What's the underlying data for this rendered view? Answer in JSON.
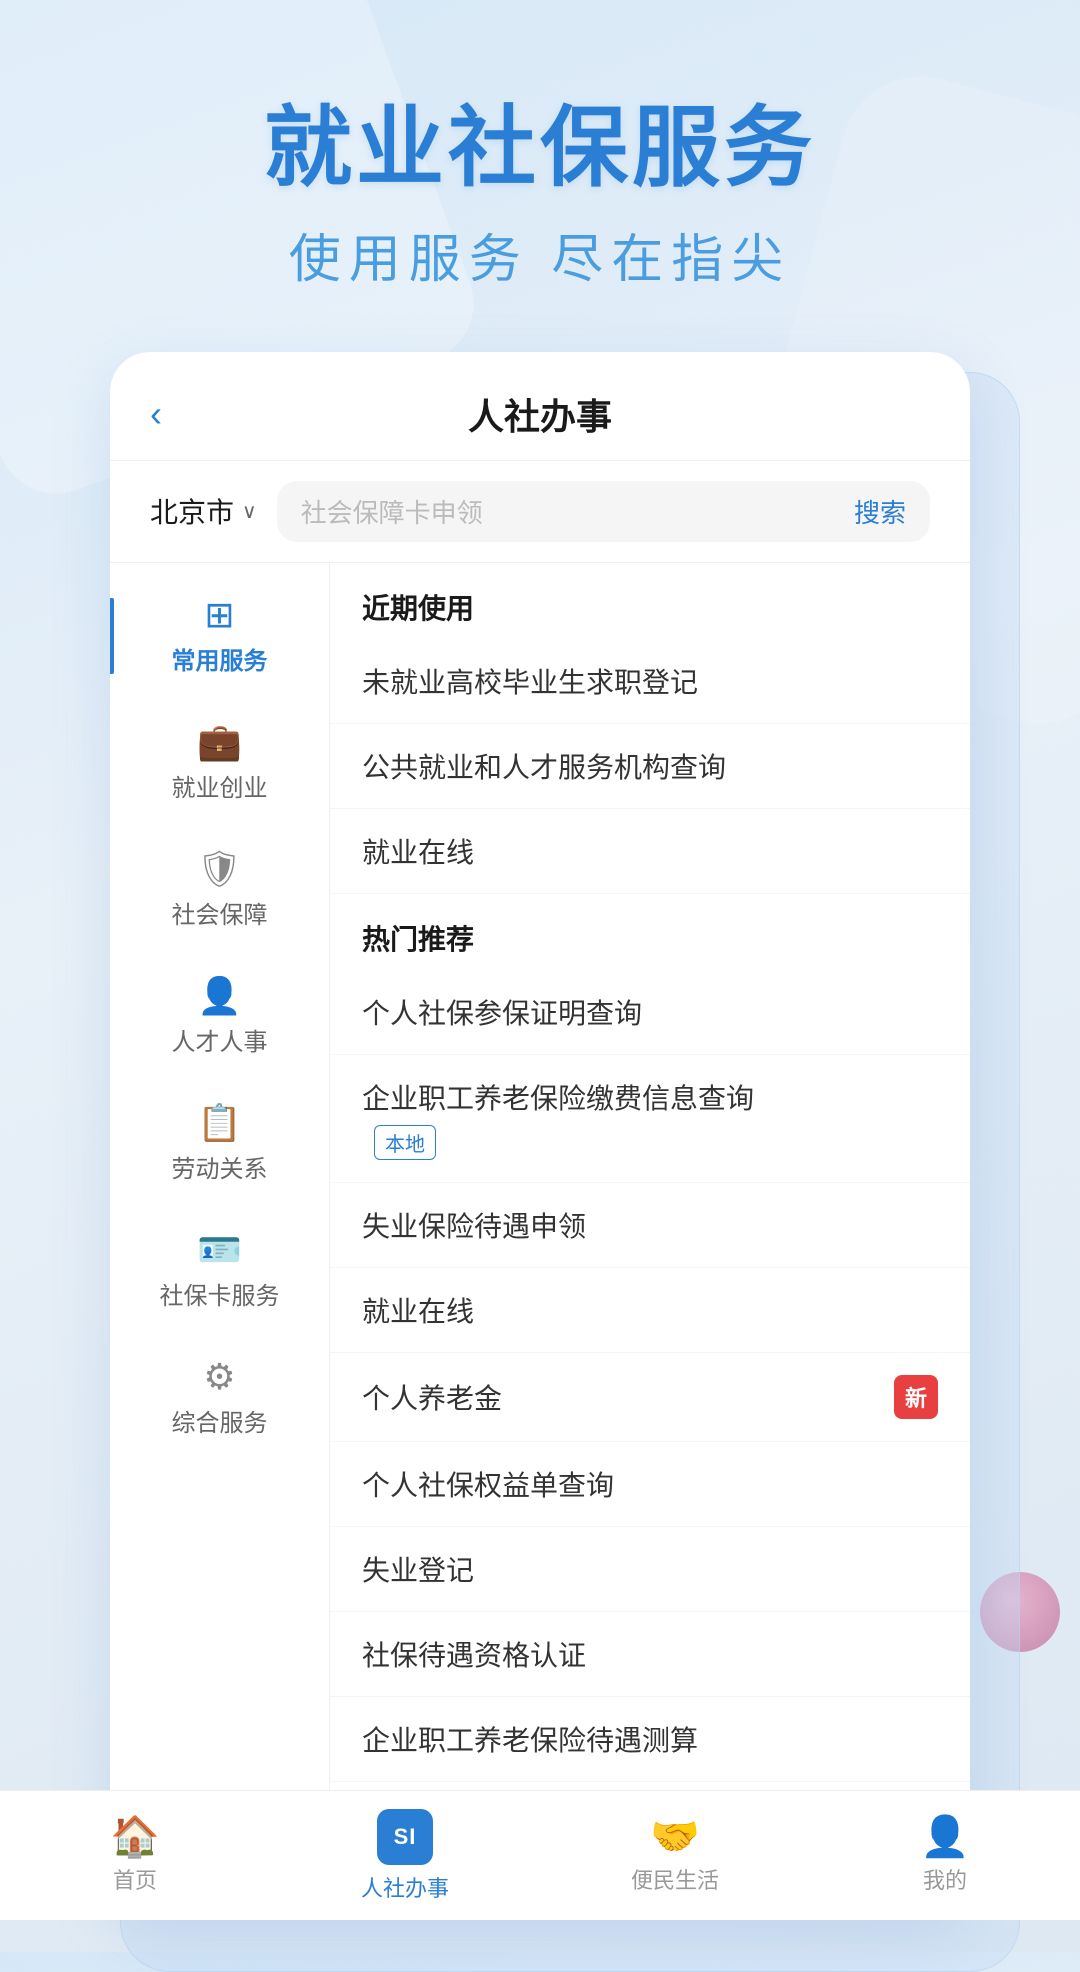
{
  "hero": {
    "title": "就业社保服务",
    "subtitle": "使用服务 尽在指尖"
  },
  "header": {
    "back_label": "‹",
    "title": "人社办事"
  },
  "search": {
    "city": "北京市",
    "placeholder": "社会保障卡申领",
    "button": "搜索"
  },
  "sidebar": {
    "items": [
      {
        "id": "common",
        "icon": "⊞",
        "label": "常用服务",
        "active": true
      },
      {
        "id": "employment",
        "icon": "🧳",
        "label": "就业创业",
        "active": false
      },
      {
        "id": "social",
        "icon": "🛡",
        "label": "社会保障",
        "active": false
      },
      {
        "id": "talent",
        "icon": "👤",
        "label": "人才人事",
        "active": false
      },
      {
        "id": "labor",
        "icon": "📋",
        "label": "劳动关系",
        "active": false
      },
      {
        "id": "card",
        "icon": "🪪",
        "label": "社保卡服务",
        "active": false
      },
      {
        "id": "general",
        "icon": "⚙",
        "label": "综合服务",
        "active": false
      }
    ]
  },
  "content": {
    "sections": [
      {
        "id": "recent",
        "title": "近期使用",
        "items": [
          {
            "id": "item1",
            "text": "未就业高校毕业生求职登记",
            "tag": null,
            "badge": null
          },
          {
            "id": "item2",
            "text": "公共就业和人才服务机构查询",
            "tag": null,
            "badge": null
          },
          {
            "id": "item3",
            "text": "就业在线",
            "tag": null,
            "badge": null
          }
        ]
      },
      {
        "id": "hot",
        "title": "热门推荐",
        "items": [
          {
            "id": "item4",
            "text": "个人社保参保证明查询",
            "tag": null,
            "badge": null
          },
          {
            "id": "item5",
            "text": "企业职工养老保险缴费信息查询",
            "tag": "本地",
            "badge": null
          },
          {
            "id": "item6",
            "text": "失业保险待遇申领",
            "tag": null,
            "badge": null
          },
          {
            "id": "item7",
            "text": "就业在线",
            "tag": null,
            "badge": null
          },
          {
            "id": "item8",
            "text": "个人养老金",
            "tag": null,
            "badge": "新"
          },
          {
            "id": "item9",
            "text": "个人社保权益单查询",
            "tag": null,
            "badge": null
          },
          {
            "id": "item10",
            "text": "失业登记",
            "tag": null,
            "badge": null
          },
          {
            "id": "item11",
            "text": "社保待遇资格认证",
            "tag": null,
            "badge": null
          },
          {
            "id": "item12",
            "text": "企业职工养老保险待遇测算",
            "tag": null,
            "badge": null
          }
        ]
      }
    ]
  },
  "bottom_nav": {
    "items": [
      {
        "id": "home",
        "icon": "🏠",
        "label": "首页",
        "active": false
      },
      {
        "id": "rshr",
        "label": "人社办事",
        "active": true,
        "si": true
      },
      {
        "id": "convenience",
        "icon": "🤝",
        "label": "便民生活",
        "active": false
      },
      {
        "id": "mine",
        "icon": "👤",
        "label": "我的",
        "active": false
      }
    ],
    "si_text": "SI"
  }
}
